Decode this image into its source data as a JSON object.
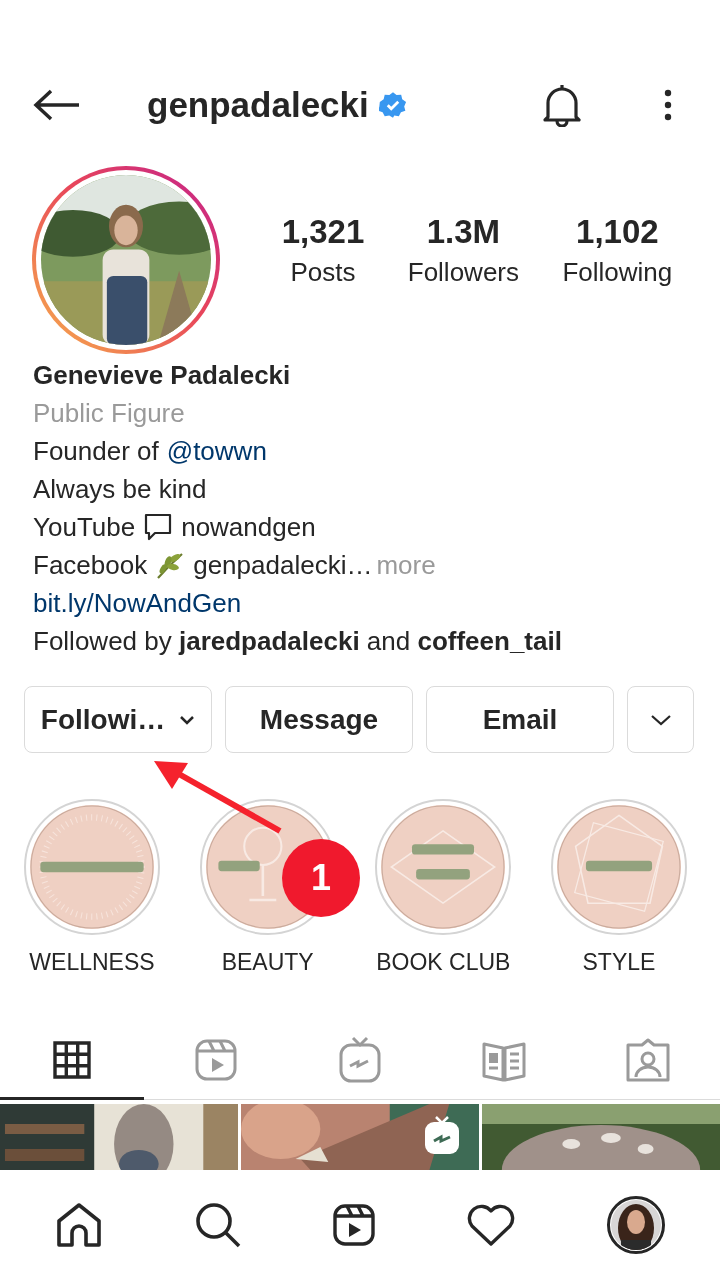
{
  "header": {
    "username": "genpadalecki",
    "verified": true
  },
  "stats": [
    {
      "value": "1,321",
      "label": "Posts"
    },
    {
      "value": "1.3M",
      "label": "Followers"
    },
    {
      "value": "1,102",
      "label": "Following"
    }
  ],
  "bio": {
    "name": "Genevieve Padalecki",
    "category": "Public Figure",
    "lines": [
      {
        "kind": "mention",
        "text": "Founder of",
        "link": "@towwn"
      },
      {
        "kind": "text",
        "text": "Always be kind"
      },
      {
        "kind": "icon",
        "text": "YouTube",
        "after": "nowandgen"
      },
      {
        "kind": "icon",
        "text": "Facebook",
        "after": "genpadalecki…",
        "more": "more"
      },
      {
        "kind": "link",
        "text": "bit.ly/NowAndGen"
      }
    ],
    "followed_by": "Followed by **jaredpadalecki** and **coffeen_tail**"
  },
  "buttons": [
    {
      "kind": "dropdown",
      "label": "Followi…"
    },
    {
      "kind": "plain",
      "label": "Message"
    },
    {
      "kind": "plain",
      "label": "Email"
    },
    {
      "kind": "caret"
    }
  ],
  "highlights": [
    {
      "label": "WELLNESS"
    },
    {
      "label": "BEAUTY"
    },
    {
      "label": "BOOK CLUB"
    },
    {
      "label": "STYLE"
    }
  ],
  "annotation": {
    "badge": "1"
  },
  "tabs": [
    {
      "selected": true
    },
    {
      "selected": false
    },
    {
      "selected": false
    },
    {
      "selected": false
    },
    {
      "selected": false
    }
  ],
  "posts": [
    {
      "kind": "picture",
      "igtv": false
    },
    {
      "kind": "picture",
      "igtv": true
    },
    {
      "kind": "picture",
      "igtv": false
    }
  ]
}
